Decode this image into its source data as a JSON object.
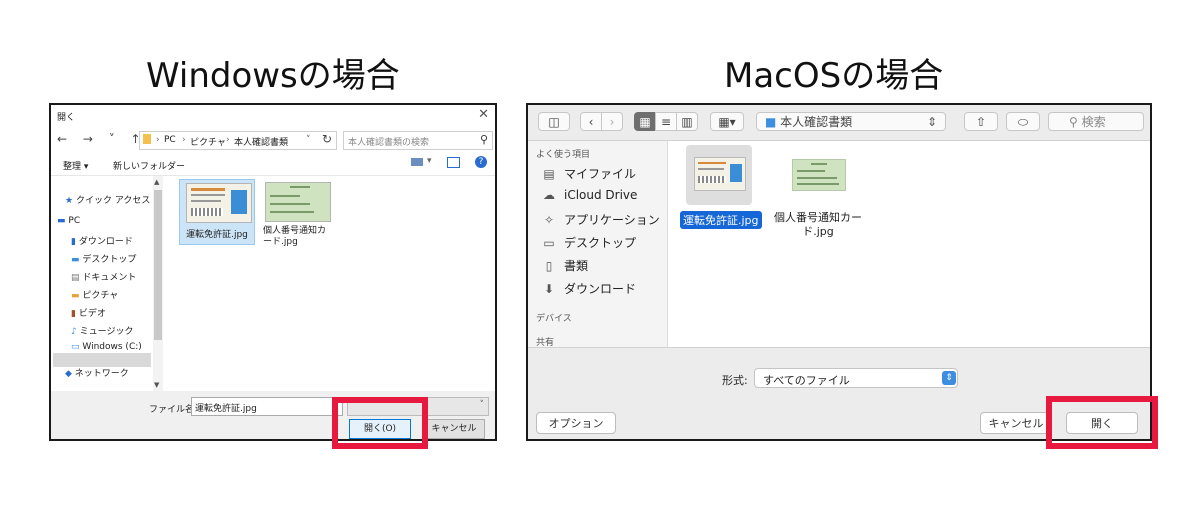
{
  "windows": {
    "heading": "Windowsの場合",
    "title": "開く",
    "nav_buttons": "← → ˅ ↑",
    "path": [
      "PC",
      "ピクチャ",
      "本人確認書類"
    ],
    "search_placeholder": "本人確認書類の検索",
    "toolbar": {
      "organize": "整理 ▾",
      "new_folder": "新しいフォルダー"
    },
    "nav_items": [
      "クイック アクセス",
      "PC",
      "ダウンロード",
      "デスクトップ",
      "ドキュメント",
      "ピクチャ",
      "ビデオ",
      "ミュージック",
      "Windows (C:)",
      "ネットワーク"
    ],
    "files": [
      {
        "name": "運転免許証.jpg",
        "selected": true
      },
      {
        "name": "個人番号通知カード.jpg",
        "selected": false
      }
    ],
    "filename_label": "ファイル名(N):",
    "filename_value": "運転免許証.jpg",
    "open_button": "開く(O)",
    "cancel_button": "キャンセル"
  },
  "mac": {
    "heading": "MacOSの場合",
    "folder": "本人確認書類",
    "search_placeholder": "検索",
    "sidebar": {
      "favorites_header": "よく使う項目",
      "items": [
        "マイファイル",
        "iCloud Drive",
        "アプリケーション",
        "デスクトップ",
        "書類",
        "ダウンロード"
      ],
      "devices_header": "デバイス",
      "shared_header": "共有"
    },
    "files": [
      {
        "name": "運転免許証.jpg",
        "selected": true
      },
      {
        "name_line1": "個人番号通知カー",
        "name_line2": "ド.jpg",
        "selected": false
      }
    ],
    "format_label": "形式:",
    "format_value": "すべてのファイル",
    "options_button": "オプション",
    "cancel_button": "キャンセル",
    "open_button": "開く"
  },
  "colors": {
    "highlight": "#e8193f",
    "mac_selection": "#1566d6",
    "win_accent": "#0078d7"
  }
}
